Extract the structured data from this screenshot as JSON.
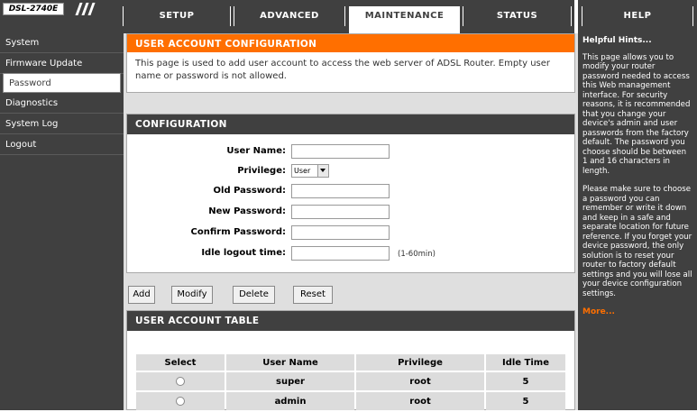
{
  "logo": {
    "model": "DSL-2740E"
  },
  "tabs": [
    {
      "label": "SETUP"
    },
    {
      "label": "ADVANCED"
    },
    {
      "label": "MAINTENANCE"
    },
    {
      "label": "STATUS"
    },
    {
      "label": "HELP"
    }
  ],
  "sidebar": {
    "items": [
      {
        "label": "System"
      },
      {
        "label": "Firmware Update"
      },
      {
        "label": "Password"
      },
      {
        "label": "Diagnostics"
      },
      {
        "label": "System Log"
      },
      {
        "label": "Logout"
      }
    ]
  },
  "account_config": {
    "title": "USER ACCOUNT CONFIGURATION",
    "description": "This page is used to add user account to access the web server of ADSL Router. Empty user name or password is not allowed."
  },
  "configuration": {
    "title": "CONFIGURATION",
    "fields": {
      "user_name_label": "User Name:",
      "privilege_label": "Privilege:",
      "privilege_value": "User",
      "old_password_label": "Old Password:",
      "new_password_label": "New Password:",
      "confirm_password_label": "Confirm Password:",
      "idle_logout_label": "Idle logout time:",
      "idle_logout_hint": "(1-60min)"
    }
  },
  "buttons": {
    "add": "Add",
    "modify": "Modify",
    "delete": "Delete",
    "reset": "Reset"
  },
  "account_table": {
    "title": "USER ACCOUNT TABLE",
    "columns": [
      "Select",
      "User Name",
      "Privilege",
      "Idle Time"
    ],
    "rows": [
      {
        "user_name": "super",
        "privilege": "root",
        "idle_time": "5"
      },
      {
        "user_name": "admin",
        "privilege": "root",
        "idle_time": "5"
      }
    ]
  },
  "help": {
    "title": "Helpful Hints...",
    "paragraph1": "This page allows you to modify your router password needed to access this Web management interface. For security reasons, it is recommended that you change your device's admin and user passwords from the factory default. The password you choose should be between 1 and 16 characters in length.",
    "paragraph2": "Please make sure to choose a password you can remember or write it down and keep in a safe and separate location for future reference. If you forget your device password, the only solution is to reset your router to factory default settings and you will lose all your device configuration settings.",
    "more": "More..."
  }
}
